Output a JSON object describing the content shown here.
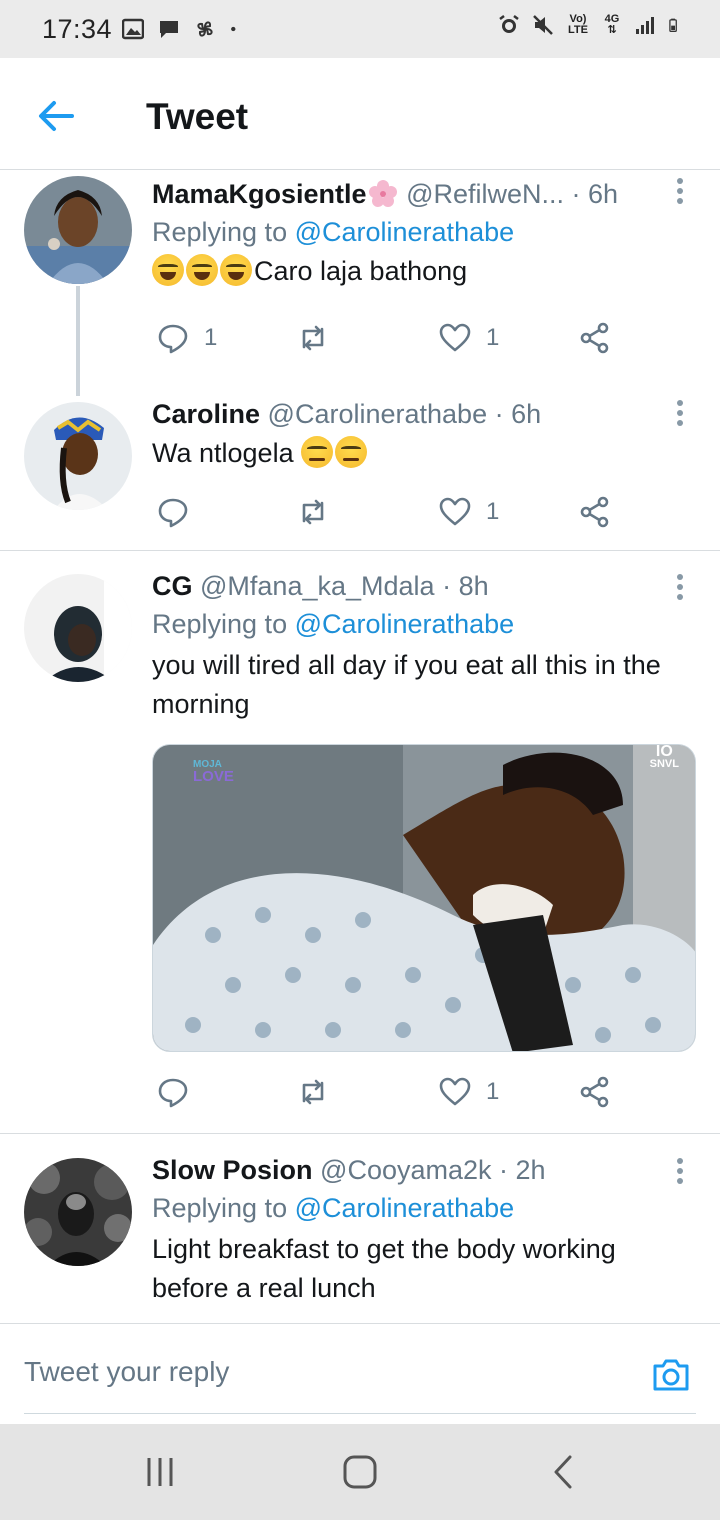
{
  "status_bar": {
    "time": "17:34",
    "network_label_top": "Vo)",
    "network_label_bottom": "LTE",
    "data_label": "4G"
  },
  "header": {
    "title": "Tweet"
  },
  "tweets": [
    {
      "name": "MamaKgosientle",
      "handle": "@RefilweN...",
      "time": "· 6h",
      "replying_prefix": "Replying to ",
      "replying_to": "@Carolinerathabe",
      "text": "Caro laja bathong",
      "reply_count": "1",
      "retweet_count": "",
      "like_count": "1"
    },
    {
      "name": "Caroline",
      "handle": "@Carolinerathabe",
      "time": "· 6h",
      "text": "Wa ntlogela",
      "reply_count": "",
      "retweet_count": "",
      "like_count": "1"
    },
    {
      "name": "CG",
      "handle": "@Mfana_ka_Mdala",
      "time": "· 8h",
      "replying_prefix": "Replying to ",
      "replying_to": "@Carolinerathabe",
      "text": "you will tired all day if you eat all this in the morning",
      "media_watermark_left_top": "MOJA",
      "media_watermark_left_bottom": "LOVE",
      "media_watermark_right_top": "IO",
      "media_watermark_right_bottom": "SNVL",
      "reply_count": "",
      "retweet_count": "",
      "like_count": "1"
    },
    {
      "name": "Slow Posion",
      "handle": "@Cooyama2k",
      "time": "· 2h",
      "replying_prefix": "Replying to ",
      "replying_to": "@Carolinerathabe",
      "text": "Light breakfast to get the body working before a real lunch"
    }
  ],
  "reply_bar": {
    "placeholder": "Tweet your reply"
  },
  "colors": {
    "accent": "#1d8fd8",
    "secondary_text": "#657786",
    "primary_text": "#14171a"
  }
}
